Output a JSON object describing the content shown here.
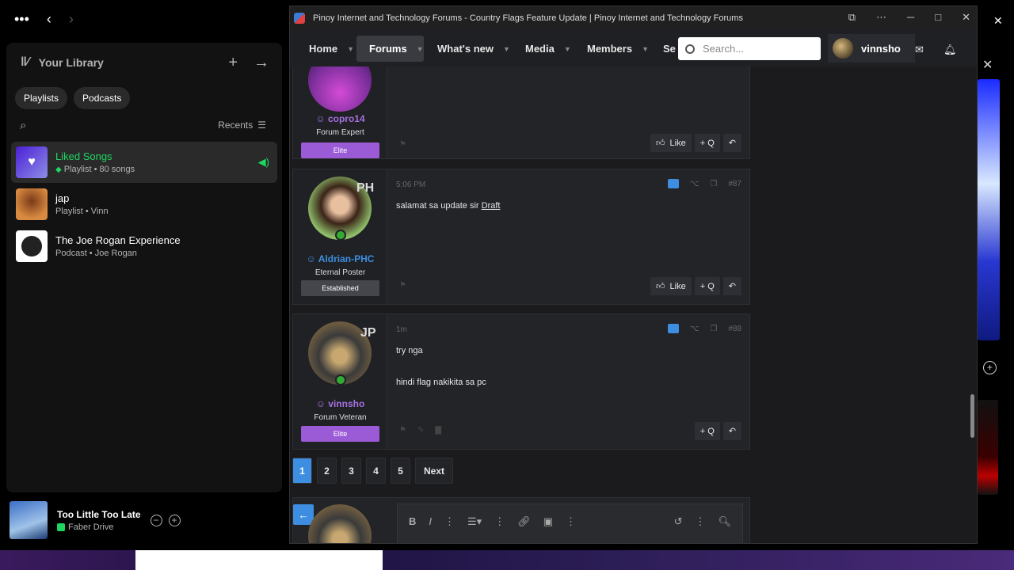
{
  "spotify": {
    "library_title": "Your Library",
    "chips": [
      "Playlists",
      "Podcasts"
    ],
    "recents_label": "Recents",
    "items": [
      {
        "title": "Liked Songs",
        "subtitle": "Playlist • 80 songs"
      },
      {
        "title": "jap",
        "subtitle": "Playlist • Vinn"
      },
      {
        "title": "The Joe Rogan Experience",
        "subtitle": "Podcast • Joe Rogan"
      }
    ],
    "player": {
      "title": "Too Little Too Late",
      "artist": "Faber Drive"
    },
    "colors": {
      "accent": "#1ed760"
    }
  },
  "browser": {
    "window_title": "Pinoy Internet and Technology Forums - Country Flags Feature Update | Pinoy Internet and Technology Forums",
    "nav": {
      "items": [
        "Home",
        "Forums",
        "What's new",
        "Media",
        "Members",
        "Se"
      ],
      "search_placeholder": "Search...",
      "username": "vinnsho"
    },
    "posts": [
      {
        "username": "copro14",
        "user_title": "Forum Expert",
        "badge": "Elite",
        "actions": {
          "like": "Like",
          "quote": "+ Q"
        }
      },
      {
        "username": "Aldrian-PHC",
        "initials": "PH",
        "user_title": "Eternal Poster",
        "badge": "Established",
        "time": "5:06 PM",
        "number": "#87",
        "body_text": "salamat sa update sir ",
        "body_link": "Draft",
        "actions": {
          "like": "Like",
          "quote": "+ Q"
        }
      },
      {
        "username": "vinnsho",
        "initials": "JP",
        "user_title": "Forum Veteran",
        "badge": "Elite",
        "time": "1m",
        "number": "#88",
        "body_line1": "try nga",
        "body_line2": "hindi flag nakikita sa pc",
        "actions": {
          "quote": "+ Q"
        }
      }
    ],
    "pagination": {
      "pages": [
        "1",
        "2",
        "3",
        "4",
        "5"
      ],
      "next": "Next",
      "current": "1"
    },
    "colors": {
      "elite": "#9b5bd6",
      "link_blue": "#3d8ee0",
      "user_purple": "#a66fe0",
      "user_blue": "#3d8ee0"
    }
  }
}
